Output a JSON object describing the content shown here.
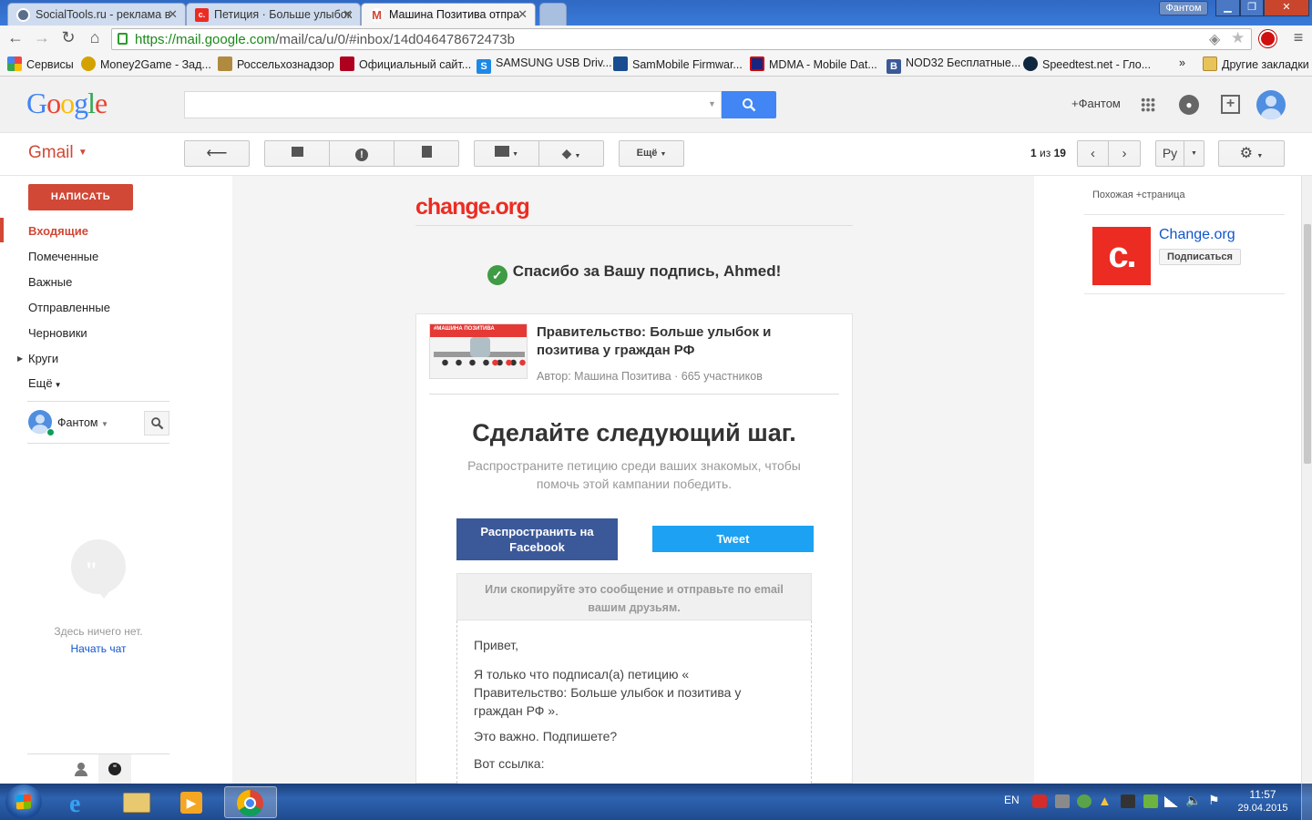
{
  "browser": {
    "tabs": [
      {
        "label": "SocialTools.ru - реклама в",
        "icon": "socialtools-icon"
      },
      {
        "label": "Петиция · Больше улыбок",
        "icon": "changeorg-icon"
      },
      {
        "label": "Машина Позитива отпра",
        "icon": "gmail-icon"
      }
    ],
    "user_badge": "Фантом",
    "url_host": "https://mail.google.com",
    "url_path": "/mail/ca/u/0/#inbox/14d046478672473b",
    "bookmarks": [
      {
        "label": "Сервисы",
        "color": "#e44"
      },
      {
        "label": "Money2Game - Зад...",
        "color": "#d4a200"
      },
      {
        "label": "Россельхознадзор",
        "color": "#b08a3e"
      },
      {
        "label": "Официальный сайт...",
        "color": "#b00020"
      },
      {
        "label": "SAMSUNG USB Driv...",
        "color": "#1e88e5"
      },
      {
        "label": "SamMobile Firmwar...",
        "color": "#1a4d8f"
      },
      {
        "label": "MDMA - Mobile Dat...",
        "color": "#1a237e"
      },
      {
        "label": "NOD32 Бесплатные...",
        "color": "#3b5998"
      },
      {
        "label": "Speedtest.net - Гло...",
        "color": "#0f2840"
      }
    ],
    "bookmarks_more": "»",
    "other_bookmarks": "Другие закладки"
  },
  "gmail": {
    "logo": "Google",
    "plus_user": "+Фантом",
    "product": "Gmail",
    "more_button": "Ещё",
    "pager_current": "1",
    "pager_of": "из",
    "pager_total": "19",
    "lang_button": "Ру",
    "compose": "НАПИСАТЬ",
    "nav": [
      {
        "label": "Входящие",
        "active": true
      },
      {
        "label": "Помеченные",
        "active": false
      },
      {
        "label": "Важные",
        "active": false
      },
      {
        "label": "Отправленные",
        "active": false
      },
      {
        "label": "Черновики",
        "active": false
      },
      {
        "label": "Круги",
        "active": false
      },
      {
        "label": "Ещё",
        "active": false
      }
    ],
    "hangouts_user": "Фантом",
    "chat_empty": "Здесь ничего нет.",
    "chat_start": "Начать чат"
  },
  "email": {
    "brand": "change.org",
    "thanks": "Спасибо за Вашу подпись, Ahmed!",
    "petition_title": "Правительство: Больше улыбок и позитива у граждан РФ",
    "petition_thumb_text": "#МАШИНА ПОЗИТИВА",
    "petition_author": "Автор: Машина Позитива · 665 участников",
    "next_step_title": "Сделайте следующий шаг.",
    "next_step_text": "Распространите петицию среди ваших знакомых, чтобы помочь этой кампании победить.",
    "facebook_button": "Распространить на Facebook",
    "tweet_button": "Tweet",
    "copy_hint": "Или скопируйте это сообщение и отправьте по email вашим друзьям.",
    "copy_body": [
      "Привет,",
      "Я только что подписал(а) петицию « Правительство: Больше улыбок и позитива у граждан РФ ».",
      "Это важно. Подпишете?",
      "Вот ссылка:"
    ]
  },
  "sidebar": {
    "header": "Похожая +страница",
    "page_name": "Change.org",
    "subscribe": "Подписаться",
    "logo_letter": "c."
  },
  "taskbar": {
    "lang": "EN",
    "time": "11:57",
    "date": "29.04.2015"
  },
  "colors": {
    "gmail_red": "#d14836",
    "change_red": "#ec2c22",
    "facebook": "#3b5998",
    "twitter": "#1da1f2",
    "google_blue": "#4285f4"
  }
}
